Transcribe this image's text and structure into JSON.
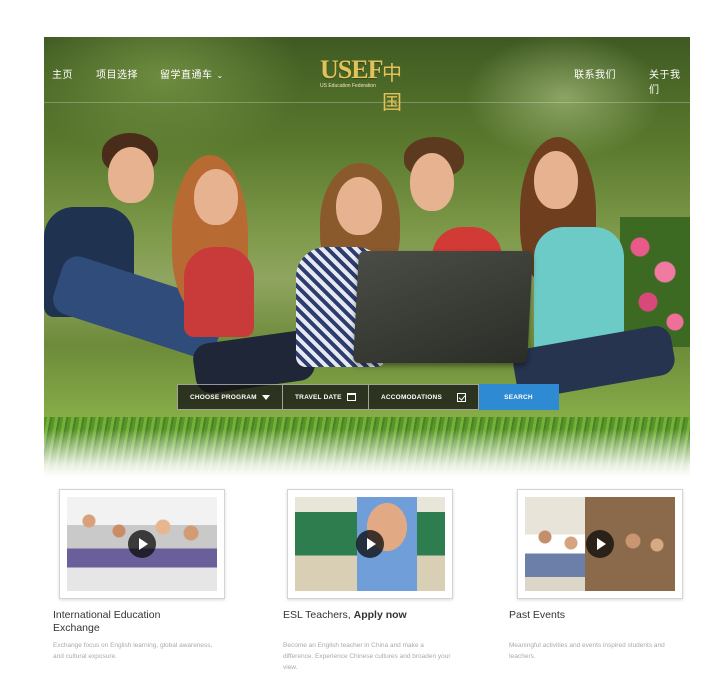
{
  "nav": {
    "left": [
      {
        "label": "主页"
      },
      {
        "label": "项目选择"
      },
      {
        "label": "留学直通车"
      }
    ],
    "right": [
      {
        "label": "联系我们"
      },
      {
        "label": "关于我们"
      }
    ],
    "logo": {
      "text": "USEF",
      "cn": "中国",
      "sub": "US Education Federation"
    }
  },
  "search": {
    "program_label": "CHOOSE PROGRAM",
    "date_label": "TRAVEL DATE",
    "accom_label": "ACCOMODATIONS",
    "search_label": "SEARCH"
  },
  "cards": [
    {
      "title": "International Education Exchange",
      "title_strong": "",
      "desc": "Exchange focus on English learning, global awareness, and cultural exposure."
    },
    {
      "title": "ESL Teachers, ",
      "title_strong": "Apply now",
      "desc": "Become an English teacher in China and make a difference. Experience Chinese cultures and broaden your view."
    },
    {
      "title": "Past Events",
      "title_strong": "",
      "desc": "Meaningful activities and events inspired students and teachers."
    }
  ],
  "colors": {
    "search_accent": "#2f8ad4",
    "logo_gold": "#e2c25a"
  },
  "icons": {
    "dropdown": "caret-down-icon",
    "calendar": "calendar-icon",
    "checkbox": "checkbox-icon",
    "play": "play-icon"
  }
}
